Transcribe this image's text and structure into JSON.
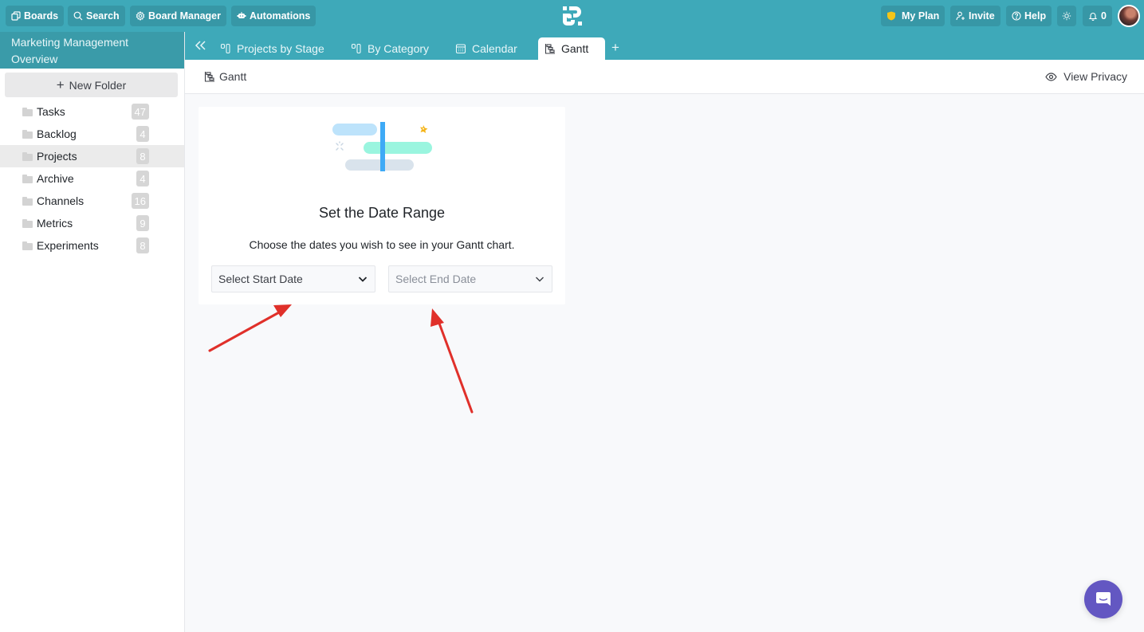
{
  "topbar": {
    "left_buttons": [
      {
        "label": "Boards",
        "icon": "boards-icon"
      },
      {
        "label": "Search",
        "icon": "search-icon"
      },
      {
        "label": "Board Manager",
        "icon": "gear-icon"
      },
      {
        "label": "Automations",
        "icon": "robot-icon"
      }
    ],
    "right_buttons": [
      {
        "label": "My Plan",
        "icon": "shield-icon"
      },
      {
        "label": "Invite",
        "icon": "user-plus-icon"
      },
      {
        "label": "Help",
        "icon": "help-circle-icon"
      },
      {
        "label": "",
        "icon": "sun-icon"
      },
      {
        "label": "0",
        "icon": "bell-icon"
      }
    ],
    "colors": {
      "bar": "#3ea9b9",
      "button": "#3797a6",
      "shield": "#f5c518"
    }
  },
  "sidebar": {
    "title": "Marketing Management Overview",
    "new_folder_label": "New Folder",
    "folders": [
      {
        "name": "Tasks",
        "count": "47",
        "active": false
      },
      {
        "name": "Backlog",
        "count": "4",
        "active": false
      },
      {
        "name": "Projects",
        "count": "8",
        "active": true
      },
      {
        "name": "Archive",
        "count": "4",
        "active": false
      },
      {
        "name": "Channels",
        "count": "16",
        "active": false
      },
      {
        "name": "Metrics",
        "count": "9",
        "active": false
      },
      {
        "name": "Experiments",
        "count": "8",
        "active": false
      }
    ]
  },
  "tabs": [
    {
      "label": "Projects by Stage",
      "icon": "kanban-icon",
      "active": false
    },
    {
      "label": "By Category",
      "icon": "kanban-icon",
      "active": false
    },
    {
      "label": "Calendar",
      "icon": "calendar-icon",
      "active": false
    },
    {
      "label": "Gantt",
      "icon": "gantt-icon",
      "active": true
    }
  ],
  "view_header": {
    "title": "Gantt",
    "privacy_label": "View Privacy"
  },
  "empty_state": {
    "title": "Set the Date Range",
    "subtitle": "Choose the dates you wish to see in your Gantt chart.",
    "start_select": {
      "placeholder": "Select Start Date",
      "value": ""
    },
    "end_select": {
      "placeholder": "Select End Date",
      "value": ""
    }
  },
  "annotations": {
    "arrow_color": "#e0302a",
    "arrows": [
      "pointing to start date select",
      "pointing to end date select"
    ]
  },
  "chat": {
    "icon": "chat-icon",
    "color": "#6357c2"
  }
}
